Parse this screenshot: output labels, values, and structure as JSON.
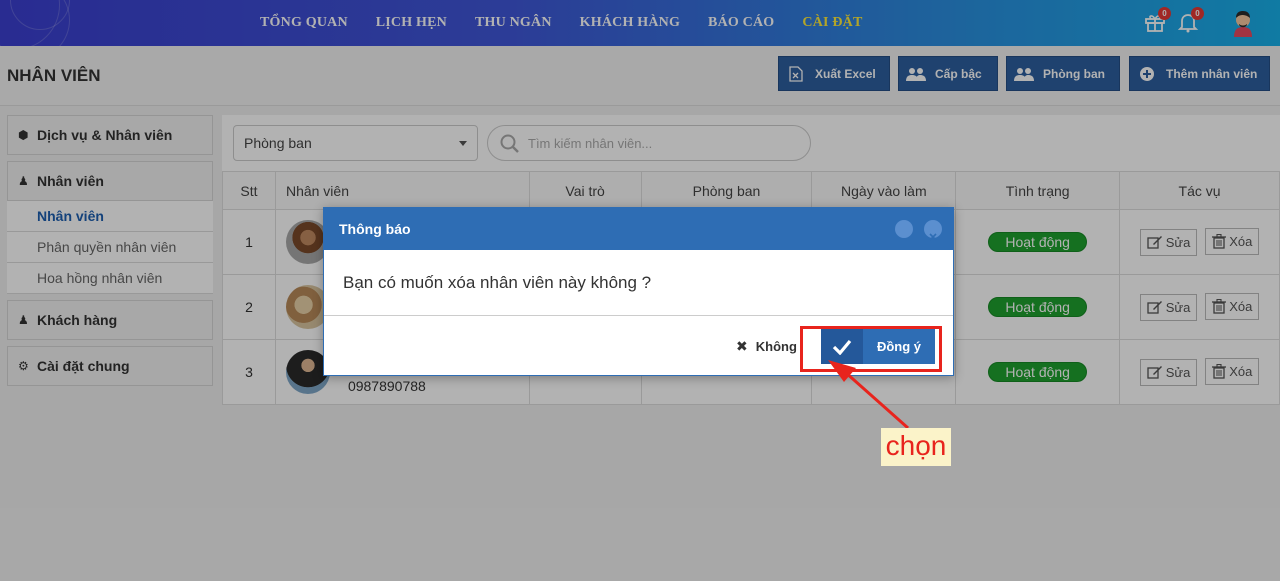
{
  "nav": {
    "items": [
      "TỔNG QUAN",
      "LỊCH HẸN",
      "THU NGÂN",
      "KHÁCH HÀNG",
      "BÁO CÁO",
      "CÀI ĐẶT"
    ],
    "active_index": 5,
    "gift_badge": "0",
    "bell_badge": "0"
  },
  "header": {
    "title": "NHÂN VIÊN",
    "buttons": {
      "export": "Xuất Excel",
      "levels": "Cấp bậc",
      "departments": "Phòng ban",
      "add_employee": "Thêm nhân viên"
    }
  },
  "sidebar": {
    "services": "Dịch vụ & Nhân viên",
    "employees": "Nhân viên",
    "sub_items": [
      "Nhân viên",
      "Phân quyền nhân viên",
      "Hoa hồng nhân viên"
    ],
    "customers": "Khách hàng",
    "general_settings": "Cài đặt chung"
  },
  "filter": {
    "department_select": "Phòng ban",
    "search_placeholder": "Tìm kiếm nhân viên..."
  },
  "table": {
    "columns": [
      "Stt",
      "Nhân viên",
      "Vai trò",
      "Phòng ban",
      "Ngày vào làm",
      "Tình trạng",
      "Tác vụ"
    ],
    "rows": [
      {
        "stt": "1",
        "phone": "",
        "status": "Hoạt động"
      },
      {
        "stt": "2",
        "phone": "",
        "status": "Hoạt động"
      },
      {
        "stt": "3",
        "phone": "0987890788",
        "status": "Hoạt động"
      }
    ],
    "edit_label": "Sửa",
    "delete_label": "Xóa"
  },
  "modal": {
    "title": "Thông báo",
    "message": "Bạn có muốn xóa nhân viên này không ?",
    "cancel_label": "Không",
    "confirm_label": "Đồng ý"
  },
  "annotation": {
    "label": "chọn",
    "color": "#e8241d"
  },
  "colors": {
    "primary": "#2e6db4",
    "status_active": "#1fa12e",
    "nav_active": "#ffeb3b"
  }
}
